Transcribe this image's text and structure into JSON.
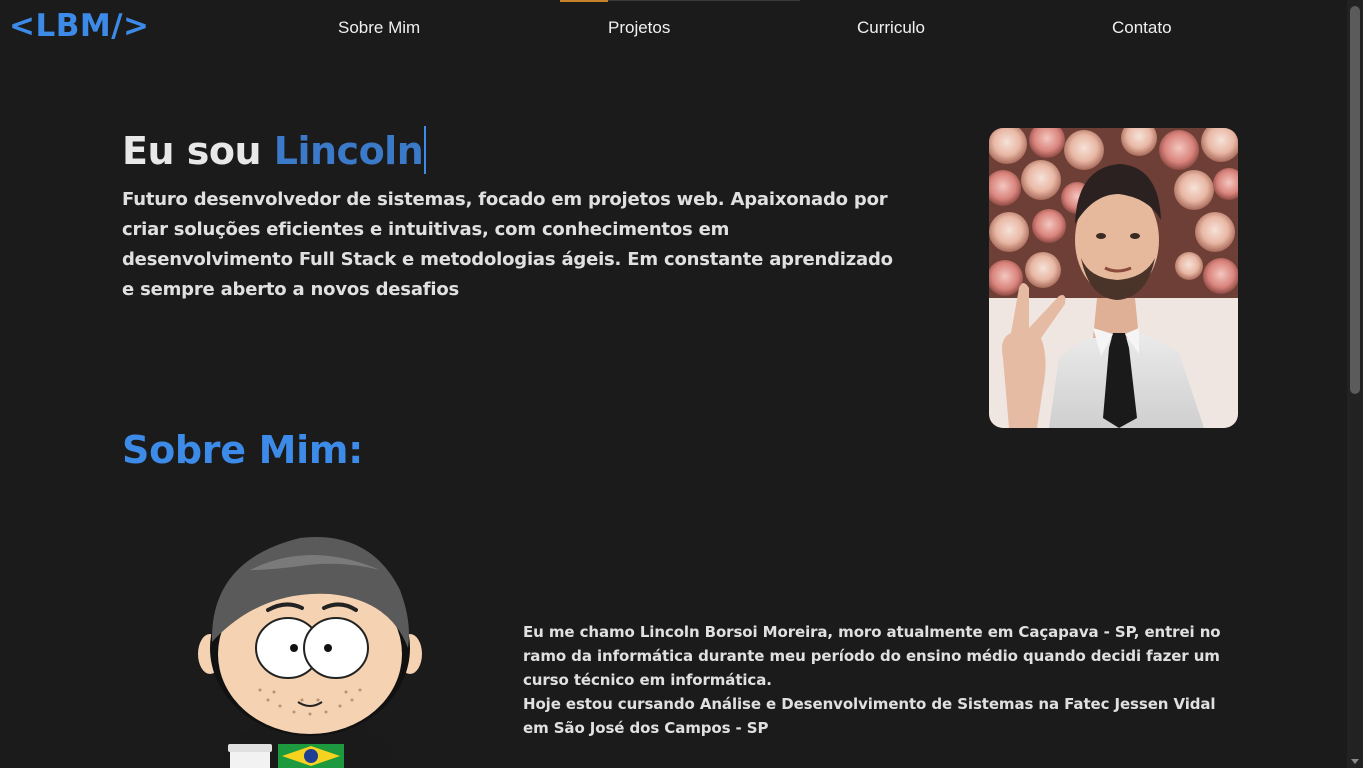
{
  "header": {
    "logo": "<LBM/>",
    "nav": [
      {
        "label": "Sobre Mim"
      },
      {
        "label": "Projetos"
      },
      {
        "label": "Curriculo"
      },
      {
        "label": "Contato"
      }
    ]
  },
  "hero": {
    "greeting": "Eu sou ",
    "name": "Lincoln",
    "description": "Futuro desenvolvedor de sistemas, focado em projetos web. Apaixonado por criar soluções eficientes e intuitivas, com conhecimentos em desenvolvimento Full Stack e metodologias ágeis. Em constante aprendizado e sempre aberto a novos desafios"
  },
  "about": {
    "title": "Sobre Mim:",
    "paragraph_1": "Eu me chamo Lincoln Borsoi Moreira, moro atualmente em Caçapava - SP, entrei no ramo da informática durante meu período do ensino médio quando decidi fazer um curso técnico em informática.",
    "paragraph_2": "Hoje estou cursando Análise e Desenvolvimento de Sistemas na Fatec Jessen Vidal em São José dos Campos - SP"
  },
  "colors": {
    "background": "#1c1b1b",
    "accent_blue": "#3d8be8",
    "name_blue": "#3b79c9",
    "nav_indicator": "#c9822c"
  }
}
